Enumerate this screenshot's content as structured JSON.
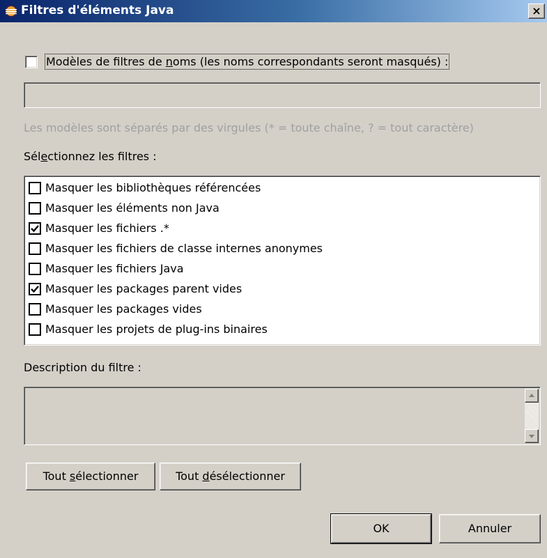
{
  "window": {
    "title": "Filtres d'éléments Java",
    "close_glyph": "×",
    "icon": "eclipse-icon"
  },
  "name_filter": {
    "checked": false,
    "label_pre": "Modèles de filtres de ",
    "label_accel": "n",
    "label_post": "oms (les noms correspondants seront masqués) :",
    "value": "",
    "hint": "Les modèles sont séparés par des virgules (* = toute chaîne, ? = tout caractère)"
  },
  "filters": {
    "label_pre": "Sél",
    "label_accel": "e",
    "label_post": "ctionnez les filtres :",
    "items": [
      {
        "label": "Masquer les bibliothèques référencées",
        "checked": false
      },
      {
        "label": "Masquer les éléments non Java",
        "checked": false
      },
      {
        "label": "Masquer les fichiers .*",
        "checked": true
      },
      {
        "label": "Masquer les fichiers de classe internes anonymes",
        "checked": false
      },
      {
        "label": "Masquer les fichiers Java",
        "checked": false
      },
      {
        "label": "Masquer les packages parent vides",
        "checked": true
      },
      {
        "label": "Masquer les packages vides",
        "checked": false
      },
      {
        "label": "Masquer les projets de plug-ins binaires",
        "checked": false
      }
    ]
  },
  "description": {
    "label": "Description du filtre :",
    "value": ""
  },
  "buttons": {
    "select_all_pre": "Tout ",
    "select_all_accel": "s",
    "select_all_post": "électionner",
    "deselect_all_pre": "Tout ",
    "deselect_all_accel": "d",
    "deselect_all_post": "ésélectionner",
    "ok": "OK",
    "cancel": "Annuler"
  },
  "colors": {
    "titlebar_start": "#0a246a",
    "titlebar_end": "#a6caf0",
    "dialog_bg": "#d4d0c8",
    "disabled_text": "#a0a0a0"
  }
}
